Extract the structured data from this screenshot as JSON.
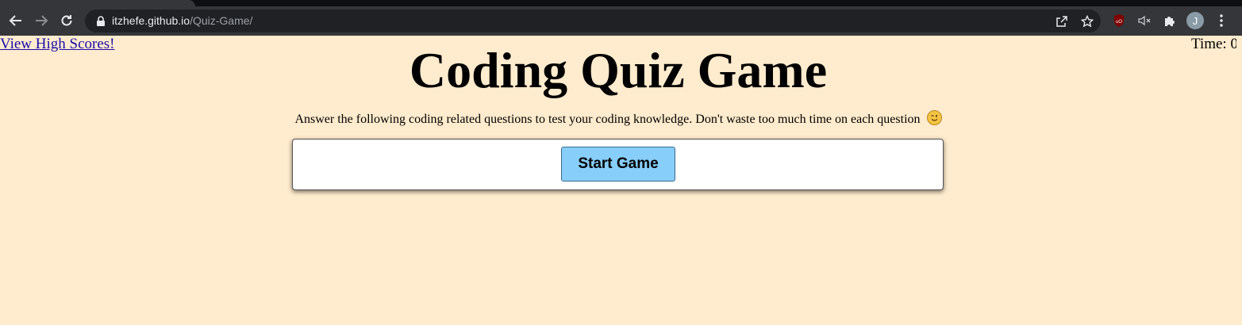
{
  "browser": {
    "url_host": "itzhefe.github.io",
    "url_path": "/Quiz-Game/",
    "profile_initial": "J",
    "icons": [
      "back-arrow-icon",
      "forward-arrow-icon",
      "reload-icon",
      "lock-icon",
      "share-icon",
      "star-icon",
      "ublock-icon",
      "muted-speaker-icon",
      "puzzle-extension-icon",
      "kebab-menu-icon"
    ]
  },
  "page": {
    "high_scores_link": "View High Scores!",
    "timer_text": "Time: 0",
    "title": "Coding Quiz Game",
    "subtitle": "Answer the following coding related questions to test your coding knowledge. Don't waste too much time on each question",
    "subtitle_emoji": "winking-face-emoji",
    "start_button": "Start Game"
  },
  "colors": {
    "page_background": "#ffebcd",
    "button_background": "#87cefa",
    "link": "#1a0dab"
  }
}
